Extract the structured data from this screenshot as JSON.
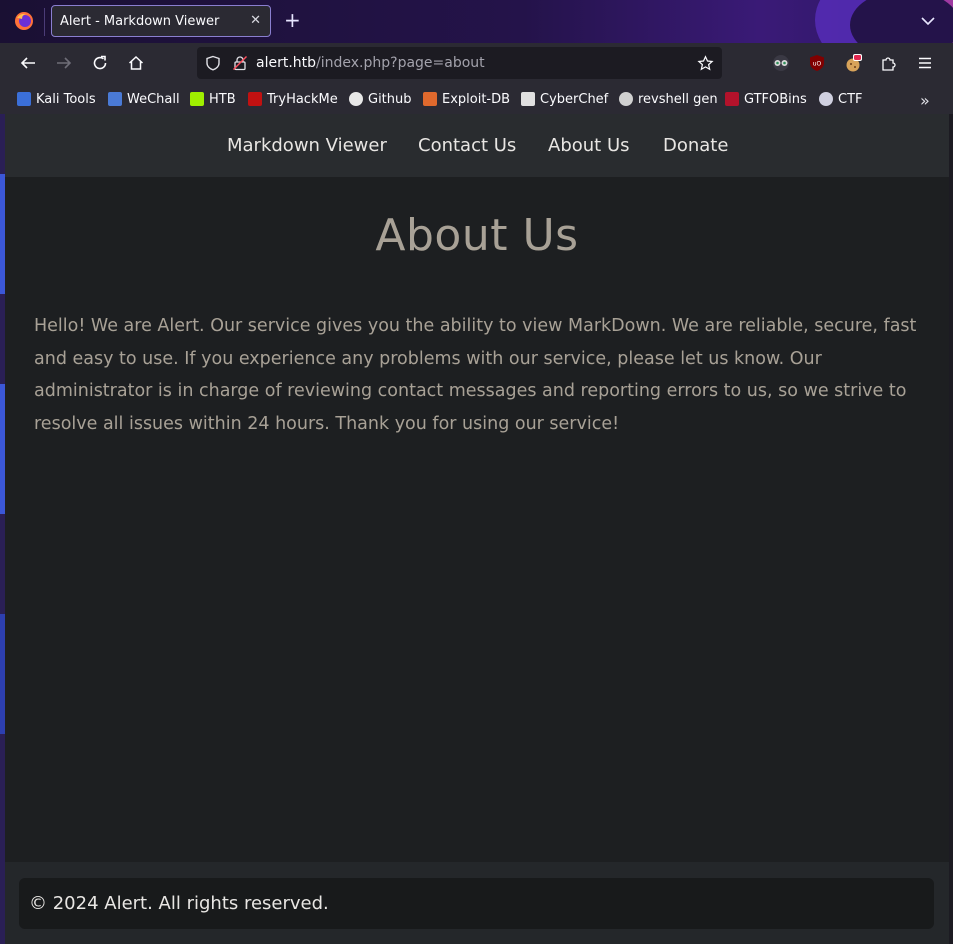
{
  "browser": {
    "tab_title": "Alert - Markdown Viewer",
    "close_glyph": "✕",
    "new_tab_glyph": "+",
    "url_host": "alert.htb",
    "url_path": "/index.php?page=about",
    "more_glyph": "»"
  },
  "bookmarks": [
    {
      "label": "Kali Tools",
      "icon": "kali-icon",
      "color": "#3b6fd8"
    },
    {
      "label": "WeChall",
      "icon": "wechall-icon",
      "color": "#4a7ad6"
    },
    {
      "label": "HTB",
      "icon": "htb-cube-icon",
      "color": "#9fef00"
    },
    {
      "label": "TryHackMe",
      "icon": "cloud-icon",
      "color": "#c11111"
    },
    {
      "label": "Github",
      "icon": "github-icon",
      "color": "#e8e8e8"
    },
    {
      "label": "Exploit-DB",
      "icon": "bug-icon",
      "color": "#e0692d"
    },
    {
      "label": "CyberChef",
      "icon": "chef-hat-icon",
      "color": "#e0e0e0"
    },
    {
      "label": "revshell gen",
      "icon": "skull-icon",
      "color": "#d0d0d0"
    },
    {
      "label": "GTFOBins",
      "icon": "gtfobins-icon",
      "color": "#b3122b"
    },
    {
      "label": "CTF",
      "icon": "globe-icon",
      "color": "#d0d0e0"
    }
  ],
  "site": {
    "nav": [
      "Markdown Viewer",
      "Contact Us",
      "About Us",
      "Donate"
    ],
    "heading": "About Us",
    "body": "Hello! We are Alert. Our service gives you the ability to view MarkDown. We are reliable, secure, fast and easy to use. If you experience any problems with our service, please let us know. Our administrator is in charge of reviewing contact messages and reporting errors to us, so we strive to resolve all issues within 24 hours. Thank you for using our service!",
    "footer": "© 2024 Alert. All rights reserved."
  }
}
